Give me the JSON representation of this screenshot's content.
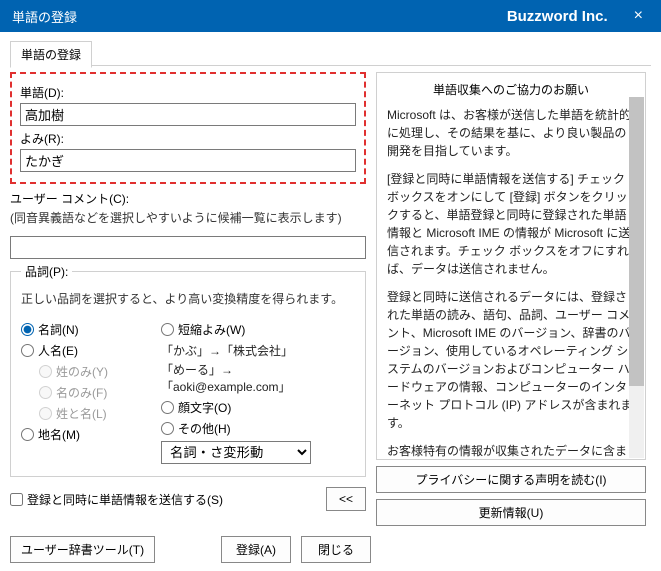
{
  "titlebar": {
    "title": "単語の登録",
    "brand": "Buzzword Inc.",
    "close": "×"
  },
  "tab": {
    "label": "単語の登録"
  },
  "fields": {
    "word_label": "単語(D):",
    "word_value": "高加樹",
    "reading_label": "よみ(R):",
    "reading_value": "たかぎ",
    "comment_label": "ユーザー コメント(C):",
    "comment_hint": "(同音異義語などを選択しやすいように候補一覧に表示します)"
  },
  "pos": {
    "legend": "品詞(P):",
    "hint": "正しい品詞を選択すると、より高い変換精度を得られます。",
    "noun": "名詞(N)",
    "person": "人名(E)",
    "surname_only": "姓のみ(Y)",
    "given_only": "名のみ(F)",
    "full_name": "姓と名(L)",
    "place": "地名(M)",
    "short": "短縮よみ(W)",
    "ex1": "「かぶ」→「株式会社」",
    "ex2": "「めーる」→「aoki@example.com」",
    "emoji": "顔文字(O)",
    "other": "その他(H)",
    "select_value": "名詞・さ変形動"
  },
  "info": {
    "title": "単語収集へのご協力のお願い",
    "p1": "Microsoft は、お客様が送信した単語を統計的に処理し、その結果を基に、より良い製品の開発を目指しています。",
    "p2": "[登録と同時に単語情報を送信する] チェック ボックスをオンにして [登録] ボタンをクリックすると、単語登録と同時に登録された単語情報と Microsoft IME の情報が Microsoft に送信されます。チェック ボックスをオフにすれば、データは送信されません。",
    "p3": "登録と同時に送信されるデータには、登録された単語の読み、語句、品詞、ユーザー コメント、Microsoft IME のバージョン、辞書のバージョン、使用しているオペレーティング システムのバージョンおよびコンピューター ハードウェアの情報、コンピューターのインターネット プロトコル (IP) アドレスが含まれます。",
    "p4": "お客様特有の情報が収集されたデータに含まれることがあります。このような情報が存在する場合でも、Microsoft では、お客様を特定するために使用することはありません。"
  },
  "buttons": {
    "privacy": "プライバシーに関する声明を読む(I)",
    "update": "更新情報(U)",
    "send_check": "登録と同時に単語情報を送信する(S)",
    "collapse": "<<",
    "user_dict": "ユーザー辞書ツール(T)",
    "register": "登録(A)",
    "close": "閉じる"
  }
}
